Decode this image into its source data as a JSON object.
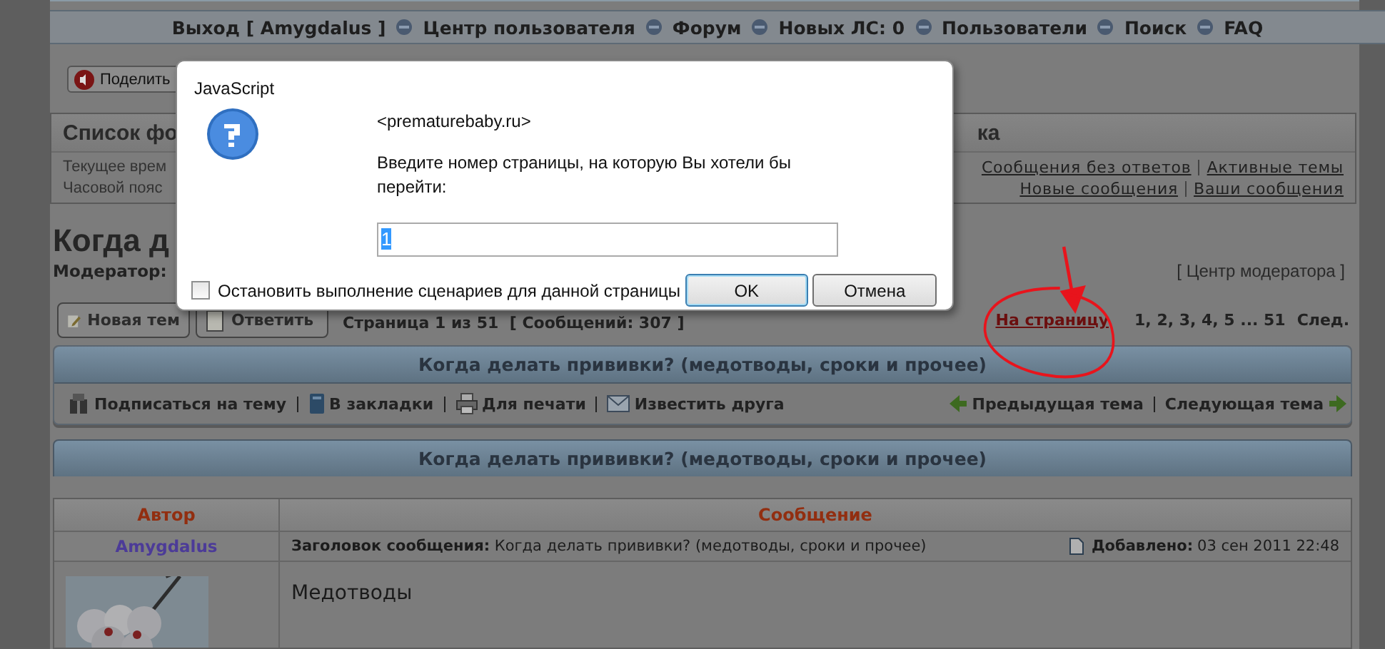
{
  "nav": [
    "Выход [ Amygdalus ]",
    "Центр пользователя",
    "Форум",
    "Новых ЛС: 0",
    "Пользователи",
    "Поиск",
    "FAQ"
  ],
  "share_button": "Поделить",
  "forum_box": {
    "title": "Список фо",
    "title_tail": "ка",
    "info": [
      "Текущее врем",
      "Часовой пояс"
    ],
    "links": [
      [
        "Сообщения без ответов",
        "Активные темы"
      ],
      [
        "Новые сообщения",
        "Ваши сообщения"
      ]
    ]
  },
  "topic_title": "Когда д",
  "moderator_label": "Модератор:",
  "moderator_center": "[ Центр модератора ]",
  "buttons": [
    {
      "kind": "new",
      "label": "Новая тем"
    },
    {
      "kind": "reply",
      "label": "Ответить"
    }
  ],
  "page_info": "Страница 1 из 51  [ Сообщений: 307 ]",
  "pagination": {
    "label": "На страницу",
    "pages": "1, 2, 3, 4, 5 ... 51",
    "next": "След."
  },
  "topic_bar": "Когда делать прививки? (медотводы, сроки и прочее)",
  "tools": [
    {
      "kind": "subscribe",
      "label": "Подписаться на тему"
    },
    {
      "kind": "bookmark",
      "label": "В закладки"
    },
    {
      "kind": "print",
      "label": "Для печати"
    },
    {
      "kind": "mail",
      "label": "Известить друга"
    }
  ],
  "nav_topics": [
    "Предыдущая тема",
    "Следующая тема"
  ],
  "topic_bar_2": "Когда делать прививки? (медотводы, сроки и прочее)",
  "post_table": {
    "columns": [
      "Автор",
      "Сообщение"
    ],
    "author": "Amygdalus",
    "subject": "**Заголовок сообщения:** Когда делать прививки? (медотводы, сроки и прочее)",
    "added_label": "Добавлено:",
    "added": "03 сен 2011 22:48",
    "body": "Медотводы"
  },
  "dialog": {
    "title": "JavaScript",
    "origin": "<prematurebaby.ru>",
    "message": "Введите номер страницы, на которую Вы хотели бы перейти:",
    "value": "1",
    "stop_scripts": {
      "label": "Остановить выполнение сценариев для данной страницы",
      "checked": false
    },
    "buttons": [
      {
        "label": "OK",
        "default": true
      },
      {
        "label": "Отмена",
        "default": false
      }
    ]
  }
}
